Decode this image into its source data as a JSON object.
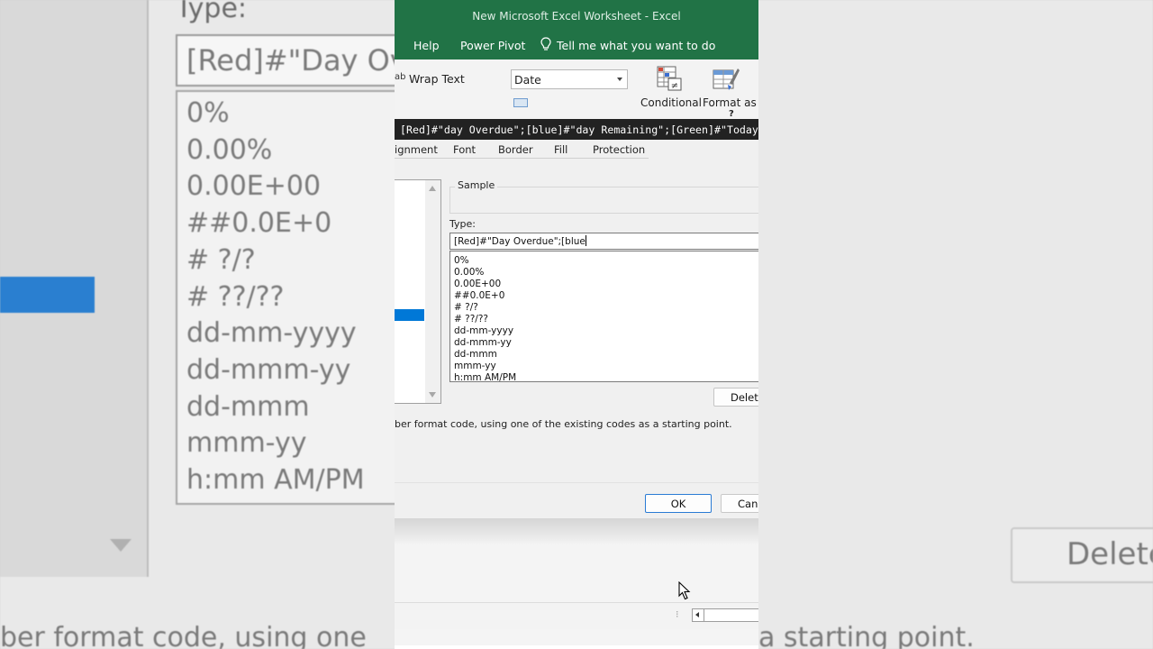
{
  "background": {
    "type_label": "Type:",
    "type_value": "[Red]#\"Day Overdue\";[blue",
    "format_items": [
      "0%",
      "0.00%",
      "0.00E+00",
      "##0.0E+0",
      "# ?/?",
      "# ??/??",
      "dd-mm-yyyy",
      "dd-mmm-yy",
      "dd-mmm",
      "mmm-yy",
      "h:mm AM/PM"
    ],
    "delete_label": "Delete",
    "hint_left": "ber format code, using one",
    "hint_right": "a starting point."
  },
  "window": {
    "title": "New Microsoft Excel Worksheet  -  Excel",
    "accent_color": "#217346"
  },
  "ribbon_tabs": {
    "help": "Help",
    "power_pivot": "Power Pivot",
    "tell_me": "Tell me what you want to do"
  },
  "ribbon": {
    "wrap_text_icon": "ab",
    "wrap_text": "Wrap Text",
    "number_format": "Date",
    "conditional": "Conditional",
    "format_as": "Format as",
    "help_q": "?"
  },
  "caption_overlay": "[Red]#\"day Overdue\";[blue]#\"day Remaining\";[Green]#\"Today\"",
  "dialog": {
    "tabs": {
      "alignment": "ignment",
      "font": "Font",
      "border": "Border",
      "fill": "Fill",
      "protection": "Protection"
    },
    "sample_label": "Sample",
    "type_label": "Type:",
    "type_value": "[Red]#\"Day Overdue\";[blue",
    "format_items": [
      "0%",
      "0.00%",
      "0.00E+00",
      "##0.0E+0",
      "# ?/?",
      "# ??/??",
      "dd-mm-yyyy",
      "dd-mmm-yy",
      "dd-mmm",
      "mmm-yy",
      "h:mm AM/PM"
    ],
    "delete_button": "Delete",
    "hint": "ber format code, using one of the existing codes as a starting point.",
    "ok_button": "OK",
    "cancel_button": "Cancel"
  },
  "status": {
    "dots": "⁝"
  }
}
